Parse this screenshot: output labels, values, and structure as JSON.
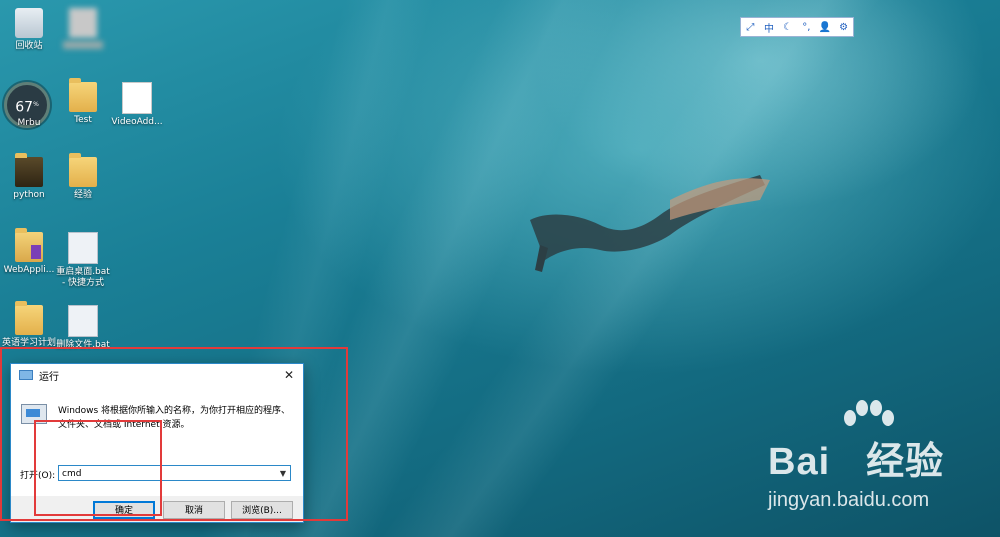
{
  "desktop": {
    "icons": [
      {
        "label": "回收站",
        "icon": "recycle-bin-icon"
      },
      {
        "label": "",
        "icon": "blurred-file-icon"
      },
      {
        "label": "Mrbu",
        "icon": "speed-gauge-icon"
      },
      {
        "label": "Test",
        "icon": "folder-icon"
      },
      {
        "label": "VideoAdd...",
        "icon": "document-icon"
      },
      {
        "label": "python",
        "icon": "folder-icon"
      },
      {
        "label": "经验",
        "icon": "folder-icon"
      },
      {
        "label": "WebAppli...",
        "icon": "visual-studio-icon"
      },
      {
        "label": "重启桌面.bat - 快捷方式",
        "icon": "bat-shortcut-icon"
      },
      {
        "label": "英语学习计划",
        "icon": "folder-icon"
      },
      {
        "label": "删除文件.bat",
        "icon": "bat-file-icon"
      }
    ],
    "gauge_value": "67",
    "gauge_unit": "%"
  },
  "ime_toolbar": {
    "items": [
      "⤢",
      "中",
      "☾",
      "°,",
      "👤",
      "⚙"
    ]
  },
  "run_dialog": {
    "title": "运行",
    "close": "✕",
    "description": "Windows 将根据你所输入的名称，为你打开相应的程序、文件夹、文档或 Internet 资源。",
    "open_label": "打开(O):",
    "input_value": "cmd",
    "buttons": {
      "ok": "确定",
      "cancel": "取消",
      "browse": "浏览(B)..."
    }
  },
  "watermark": {
    "brand": "Bai",
    "brand2": "经验",
    "url": "jingyan.baidu.com"
  },
  "colors": {
    "highlight": "#e23a3a",
    "accent": "#2b88c8"
  }
}
